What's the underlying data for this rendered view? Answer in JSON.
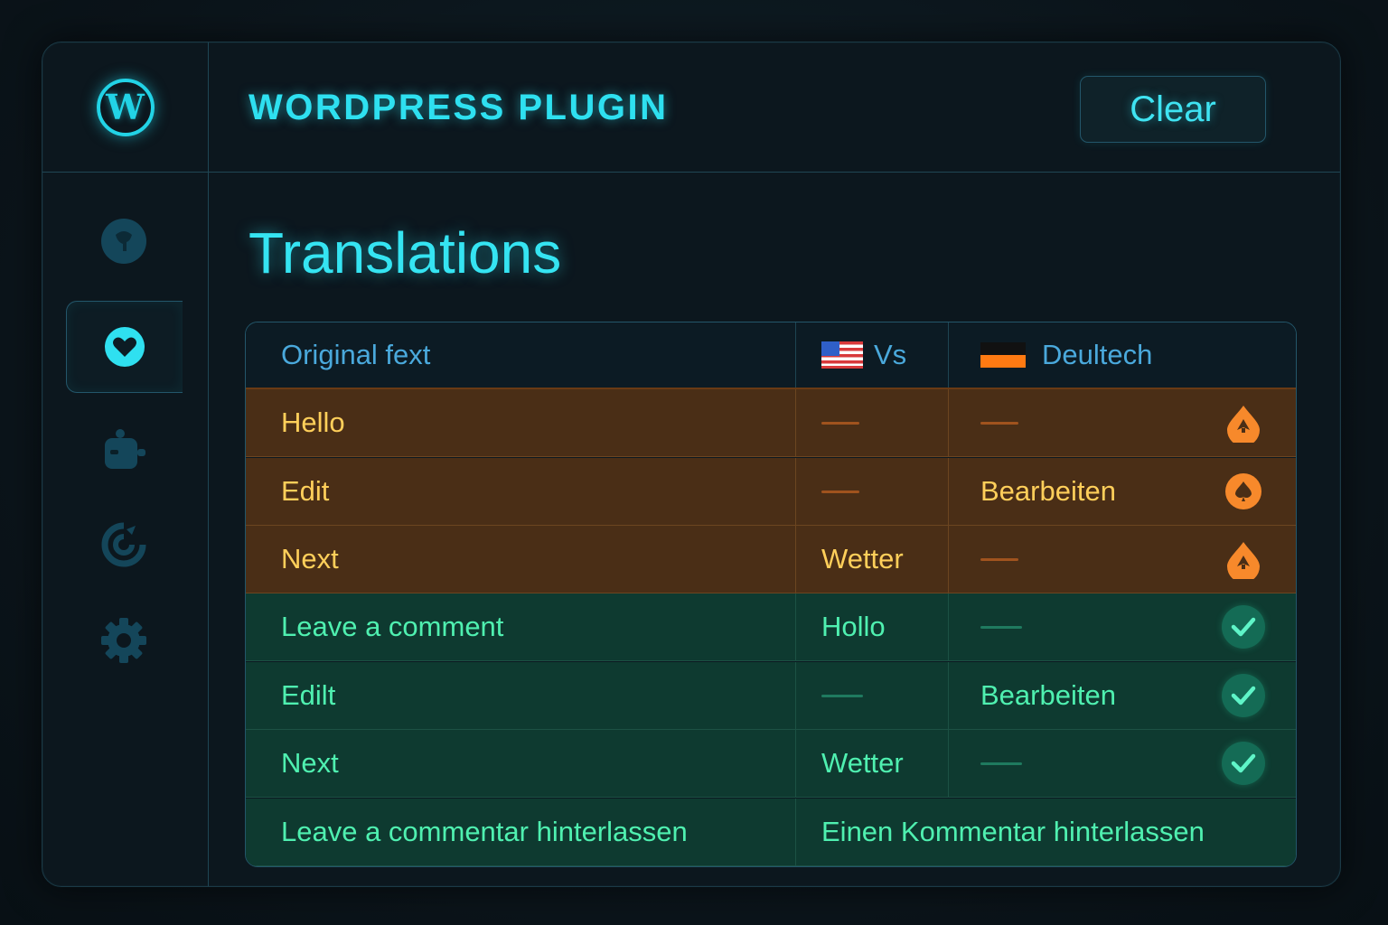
{
  "app": {
    "title": "WORDPRESS PLUGIN",
    "logo_letter": "W"
  },
  "header": {
    "clear_label": "Clear"
  },
  "page": {
    "title": "Translations"
  },
  "sidebar": {
    "items": [
      {
        "icon": "globe-icon",
        "active": false
      },
      {
        "icon": "heart-icon",
        "active": true
      },
      {
        "icon": "robot-icon",
        "active": false
      },
      {
        "icon": "refresh-icon",
        "active": false
      },
      {
        "icon": "gear-icon",
        "active": false
      }
    ]
  },
  "table": {
    "columns": [
      {
        "label": "Original fext"
      },
      {
        "label": "Vs",
        "flag": "us-flag-icon"
      },
      {
        "label": "Deultech",
        "flag": "de-flag-icon"
      }
    ],
    "rows": [
      {
        "original": "Hello",
        "col2": "",
        "col3": "",
        "status": "pending"
      },
      {
        "original": "Edit",
        "col2": "",
        "col3": "Bearbeiten",
        "status": "pending"
      },
      {
        "original": "Next",
        "col2": "Wetter",
        "col3": "",
        "status": "pending"
      },
      {
        "original": "Leave a comment",
        "col2": "Hollo",
        "col3": "",
        "status": "done"
      },
      {
        "original": "Edilt",
        "col2": "",
        "col3": "Bearbeiten",
        "status": "done"
      },
      {
        "original": "Next",
        "col2": "Wetter",
        "col3": "",
        "status": "done"
      }
    ],
    "last_row": {
      "original": "Leave a commentar hinterlassen",
      "translation": "Einen Kommentar hinterlassen"
    }
  },
  "colors": {
    "accent": "#22d3e6",
    "pending_bg": "#4a2e16",
    "pending_text": "#ffcf5a",
    "done_bg": "#0e3a30",
    "done_text": "#4ff0b0",
    "warning_icon": "#f7892b",
    "check_icon": "#146b55"
  }
}
